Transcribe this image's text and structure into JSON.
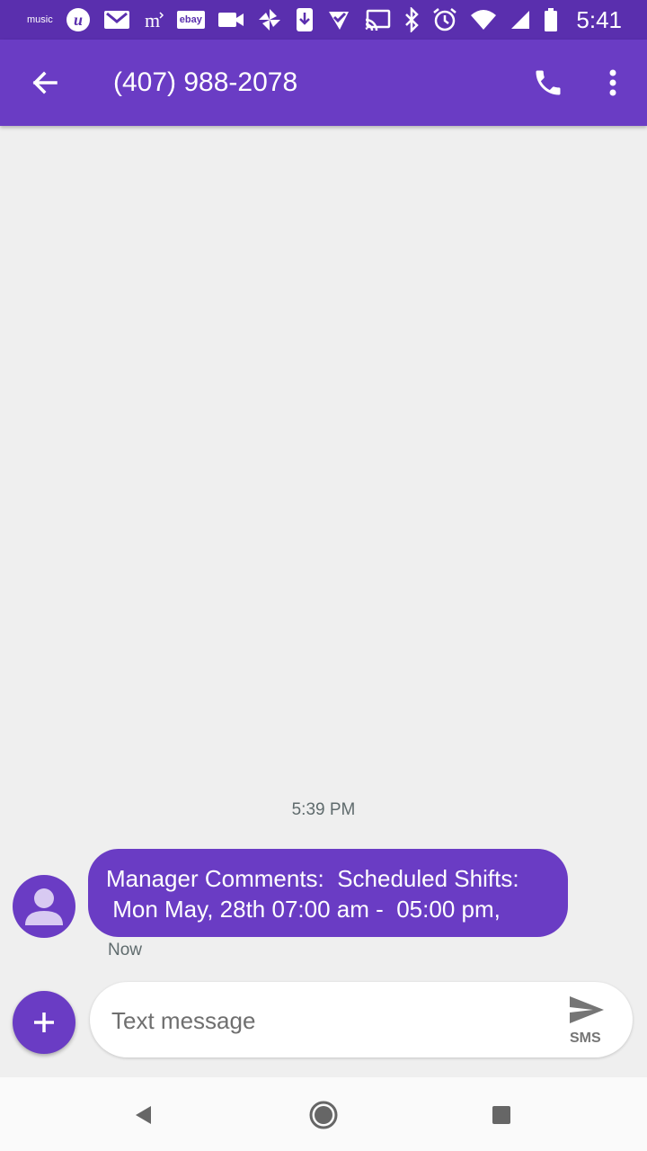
{
  "status_bar": {
    "time": "5:41",
    "left_icons": [
      "amazon-music-icon",
      "u-app-icon",
      "gmail-icon",
      "m-app-icon",
      "ebay-icon",
      "video-icon",
      "pinwheel-icon",
      "download-icon",
      "check-app-icon"
    ],
    "music_label": "music",
    "ebay_label": "ebay",
    "right_icons": [
      "cast-icon",
      "bluetooth-icon",
      "alarm-icon",
      "wifi-icon",
      "signal-icon",
      "battery-icon"
    ]
  },
  "app_bar": {
    "title": "(407) 988-2078",
    "background": "#6a3cc4"
  },
  "conversation": {
    "timestamp": "5:39 PM",
    "messages": [
      {
        "lines": [
          "Manager Comments:  Scheduled Shifts:",
          " Mon May, 28th 07:00 am -  05:00 pm,"
        ],
        "time": "Now",
        "color": "#6a3cc4"
      }
    ]
  },
  "composer": {
    "placeholder": "Text message",
    "send_label": "SMS"
  },
  "nav_bar": {
    "buttons": [
      "back-triangle-icon",
      "home-circle-icon",
      "recents-square-icon"
    ]
  }
}
